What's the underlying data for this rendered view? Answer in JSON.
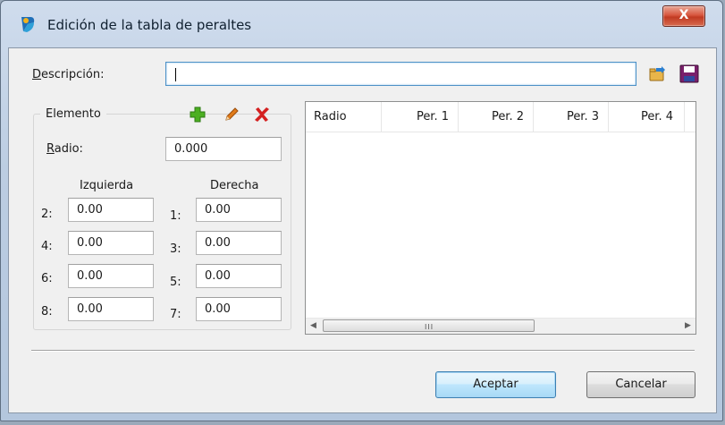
{
  "window": {
    "title": "Edición de la tabla de peraltes",
    "close_label": "X"
  },
  "descripcion": {
    "label_underlined": "D",
    "label_rest": "escripción:",
    "value": ""
  },
  "elemento": {
    "title": "Elemento",
    "radio_label_underlined": "R",
    "radio_label_rest": "adio:",
    "radio_value": "0.000",
    "izquierda_header": "Izquierda",
    "derecha_header": "Derecha",
    "izquierda": [
      {
        "label": "2:",
        "value": "0.00"
      },
      {
        "label": "4:",
        "value": "0.00"
      },
      {
        "label": "6:",
        "value": "0.00"
      },
      {
        "label": "8:",
        "value": "0.00"
      }
    ],
    "derecha": [
      {
        "label": "1:",
        "value": "0.00"
      },
      {
        "label": "3:",
        "value": "0.00"
      },
      {
        "label": "5:",
        "value": "0.00"
      },
      {
        "label": "7:",
        "value": "0.00"
      }
    ]
  },
  "table": {
    "columns": [
      "Radio",
      "Per. 1",
      "Per. 2",
      "Per. 3",
      "Per. 4"
    ],
    "rows": [],
    "scroll_grip": "III"
  },
  "buttons": {
    "accept": "Aceptar",
    "cancel": "Cancelar"
  },
  "icons": {
    "app": "app-logo-icon",
    "load": "open-folder-icon",
    "save": "floppy-disk-icon",
    "add": "plus-icon",
    "edit": "pencil-icon",
    "delete": "red-x-icon"
  },
  "colors": {
    "add": "#4caf22",
    "edit": "#e07b1a",
    "delete": "#d42020",
    "save": "#7a1f6b",
    "close_button": "#c8402a"
  }
}
